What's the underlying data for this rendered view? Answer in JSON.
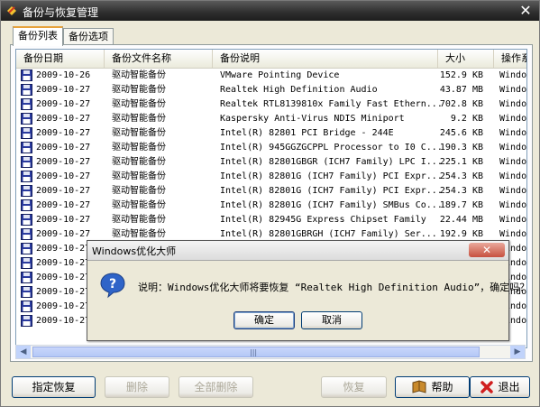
{
  "window": {
    "title": "备份与恢复管理",
    "close": "✕"
  },
  "tabs": [
    {
      "label": "备份列表"
    },
    {
      "label": "备份选项"
    }
  ],
  "columns": [
    "备份日期",
    "备份文件名称",
    "备份说明",
    "大小",
    "操作系统"
  ],
  "rows": [
    [
      "2009-10-26",
      "驱动智能备份",
      "VMware Pointing Device",
      "152.9 KB",
      "Windows"
    ],
    [
      "2009-10-27",
      "驱动智能备份",
      "Realtek High Definition Audio",
      "43.87 MB",
      "Windows"
    ],
    [
      "2009-10-27",
      "驱动智能备份",
      "Realtek RTL8139810x Family Fast Ethern...",
      "702.8 KB",
      "Windows"
    ],
    [
      "2009-10-27",
      "驱动智能备份",
      "Kaspersky Anti-Virus NDIS Miniport",
      "9.2 KB",
      "Windows"
    ],
    [
      "2009-10-27",
      "驱动智能备份",
      "Intel(R) 82801 PCI Bridge - 244E",
      "245.6 KB",
      "Windows"
    ],
    [
      "2009-10-27",
      "驱动智能备份",
      "Intel(R) 945GGZGCPPL Processor to I0 C...",
      "190.3 KB",
      "Windows"
    ],
    [
      "2009-10-27",
      "驱动智能备份",
      "Intel(R) 82801GBGR (ICH7 Family) LPC I...",
      "225.1 KB",
      "Windows"
    ],
    [
      "2009-10-27",
      "驱动智能备份",
      "Intel(R) 82801G (ICH7 Family) PCI Expr...",
      "254.3 KB",
      "Windows"
    ],
    [
      "2009-10-27",
      "驱动智能备份",
      "Intel(R) 82801G (ICH7 Family) PCI Expr...",
      "254.3 KB",
      "Windows"
    ],
    [
      "2009-10-27",
      "驱动智能备份",
      "Intel(R) 82801G (ICH7 Family) SMBus Co...",
      "189.7 KB",
      "Windows"
    ],
    [
      "2009-10-27",
      "驱动智能备份",
      "Intel(R) 82945G Express Chipset Family",
      "22.44 MB",
      "Windows"
    ],
    [
      "2009-10-27",
      "驱动智能备份",
      "Intel(R) 82801GBRGH (ICH7 Family) Ser...",
      "192.9 KB",
      "Windows"
    ],
    [
      "2009-10-27",
      "",
      "",
      "",
      "Windows"
    ],
    [
      "2009-10-27",
      "",
      "",
      "",
      "Windows"
    ],
    [
      "2009-10-27",
      "",
      "",
      "",
      "Windows"
    ],
    [
      "2009-10-27",
      "",
      "",
      "",
      "Windows"
    ],
    [
      "2009-10-27",
      "",
      "",
      "",
      "Windows"
    ],
    [
      "2009-10-27",
      "",
      "",
      "",
      "Windows"
    ]
  ],
  "scrollbar": {
    "left": "◀",
    "right": "▶",
    "grip": "|||"
  },
  "buttons": {
    "restore_specified": "指定恢复",
    "delete": "删除",
    "delete_all": "全部删除",
    "restore": "恢复",
    "help": "帮助",
    "exit": "退出"
  },
  "dialog": {
    "title": "Windows优化大师",
    "close": "✕",
    "message": "说明：Windows优化大师将要恢复 “Realtek High Definition Audio”，确定吗？",
    "ok": "确定",
    "cancel": "取消"
  },
  "colors": {
    "title_bar": "#2d2d2d",
    "accent_tab": "#e6a23c",
    "floppy": "#2a3a9e",
    "question_icon": "#2f64c8"
  }
}
